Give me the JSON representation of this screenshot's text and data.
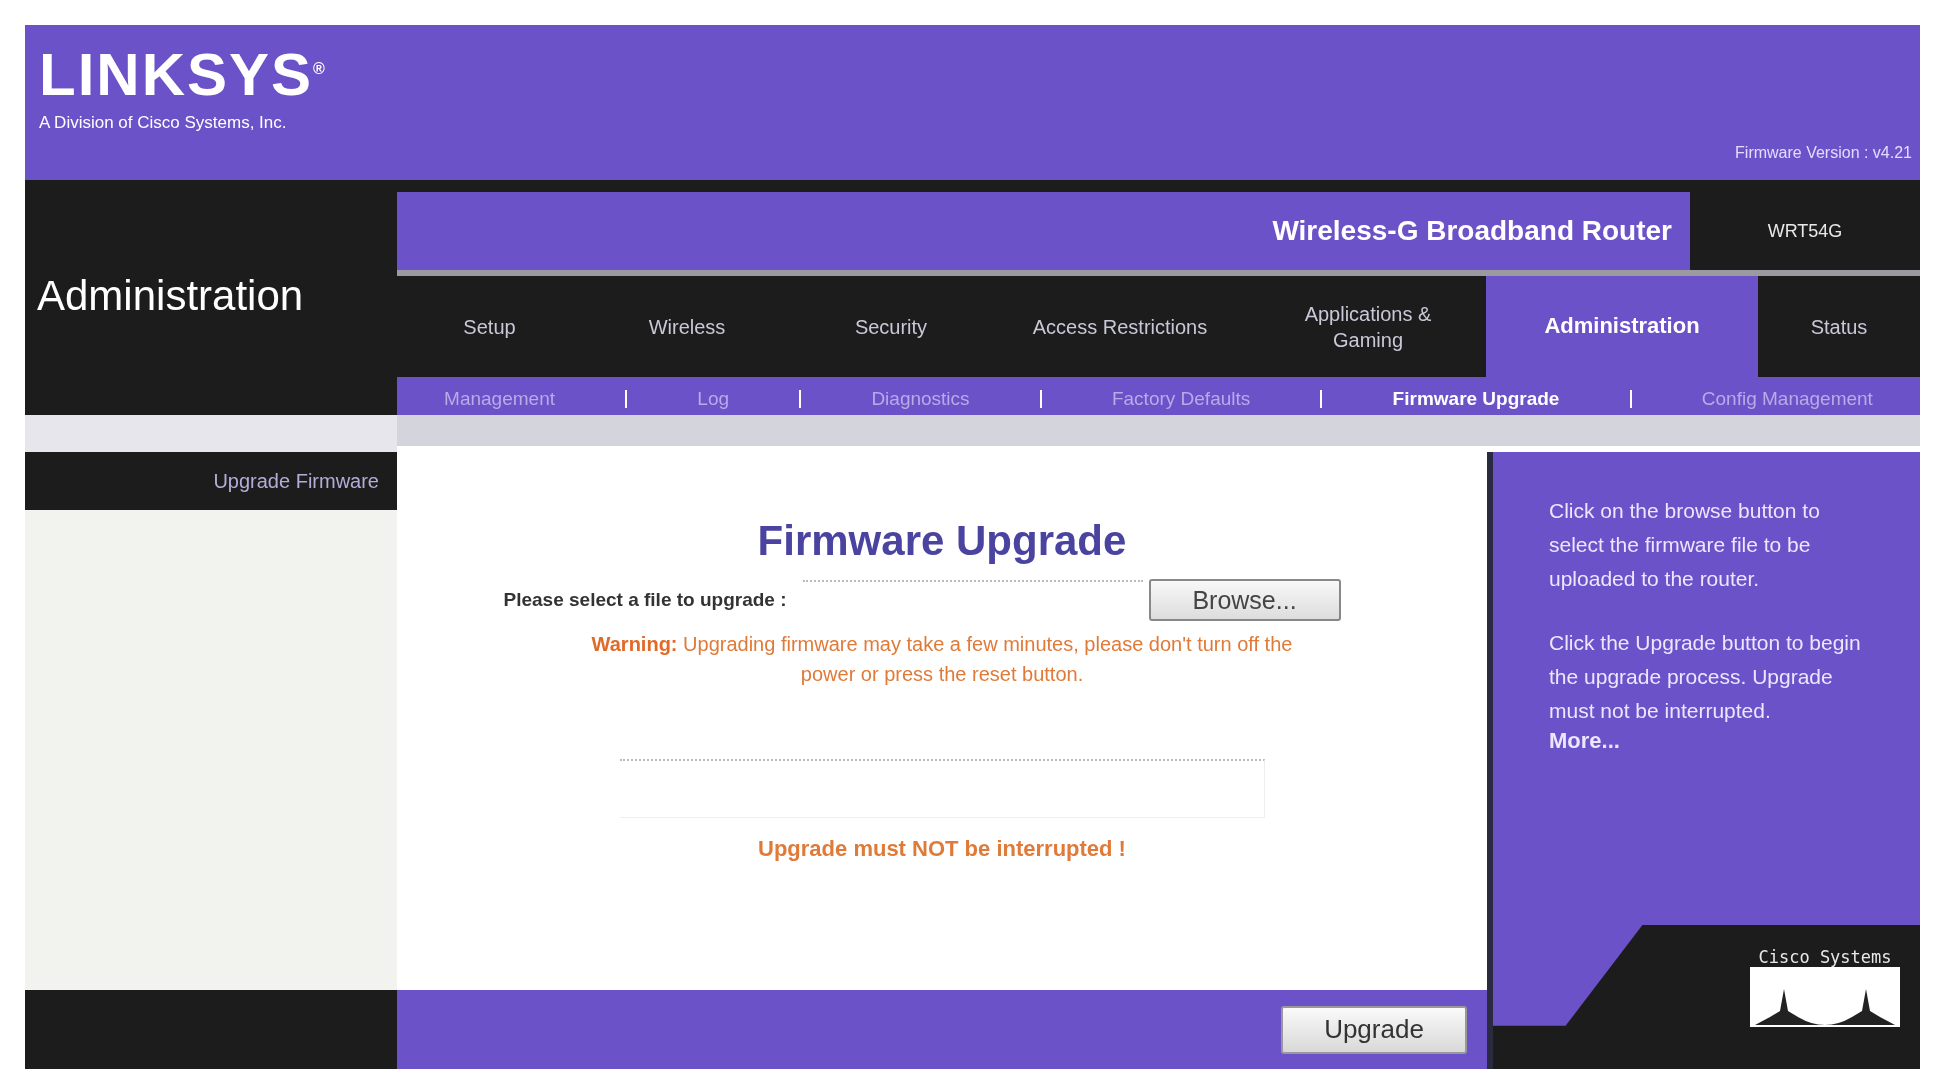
{
  "header": {
    "brand": "LINKSYS$^{®}$",
    "tagline": "A Division of Cisco Systems, Inc.",
    "firmware_version": "Firmware Version : v4.21"
  },
  "section_title": "Administration",
  "product_name": "Wireless-G Broadband Router",
  "model": "WRT54G",
  "tabs": [
    {
      "label": "Setup",
      "selected": false
    },
    {
      "label": "Wireless",
      "selected": false
    },
    {
      "label": "Security",
      "selected": false
    },
    {
      "label": "Access Restrictions",
      "selected": false
    },
    {
      "label": "Applications & Gaming",
      "selected": false
    },
    {
      "label": "Administration",
      "selected": true
    },
    {
      "label": "Status",
      "selected": false
    }
  ],
  "subtabs": [
    {
      "label": "Management",
      "selected": false
    },
    {
      "label": "Log",
      "selected": false
    },
    {
      "label": "Diagnostics",
      "selected": false
    },
    {
      "label": "Factory Defaults",
      "selected": false
    },
    {
      "label": "Firmware Upgrade",
      "selected": true
    },
    {
      "label": "Config Management",
      "selected": false
    }
  ],
  "sidebar": {
    "heading": "Upgrade Firmware"
  },
  "main": {
    "title": "Firmware Upgrade",
    "file_label": "Please select a file to upgrade :",
    "browse_button": "Browse...",
    "warning": "**Warning:** Upgrading firmware may take a few minutes, please don't turn off the power or press the reset button.",
    "notice": "Upgrade must NOT be interrupted !"
  },
  "help": {
    "paragraphs": [
      "Click on the browse button to select the firmware file to be uploaded to the router.",
      "Click the Upgrade button to begin the upgrade process. Upgrade must not be interrupted."
    ],
    "more_link": "More..."
  },
  "footer": {
    "upgrade_button": "Upgrade",
    "logo_text": "Cisco Systems"
  }
}
